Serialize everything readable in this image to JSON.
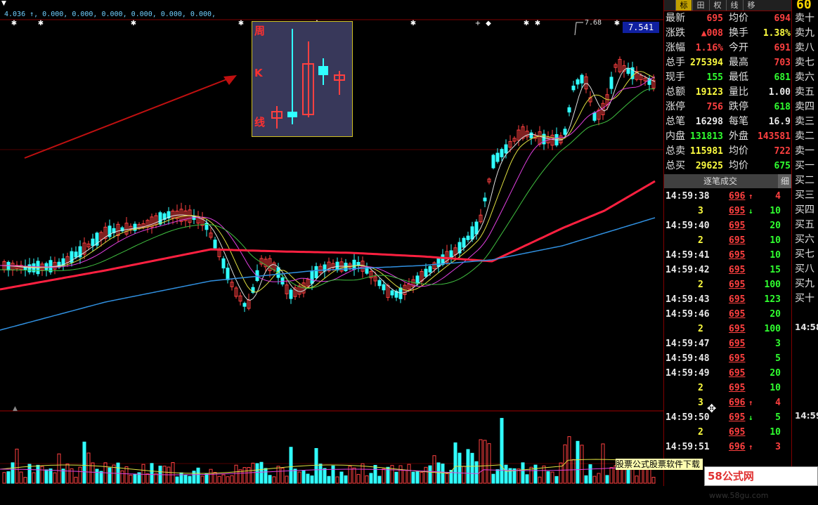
{
  "chart": {
    "ma_header": "4.036 ↑, 0.000, 0.000, 0.000, 0.000, 0.000, 0.000,",
    "peak_label": "7.68",
    "price_tag": "7.541",
    "inset_chars": [
      "周",
      "K",
      "线"
    ]
  },
  "tabs": [
    "标",
    "田",
    "权",
    "线",
    "移"
  ],
  "quote": [
    {
      "l1": "最新",
      "v1": "695",
      "c1": "red",
      "l2": "均价",
      "v2": "694",
      "c2": "red"
    },
    {
      "l1": "涨跌",
      "v1": "▲008",
      "c1": "red",
      "l2": "换手",
      "v2": "1.38%",
      "c2": "yel"
    },
    {
      "l1": "涨幅",
      "v1": "1.16%",
      "c1": "red",
      "l2": "今开",
      "v2": "691",
      "c2": "red"
    },
    {
      "l1": "总手",
      "v1": "275394",
      "c1": "yel",
      "l2": "最高",
      "v2": "703",
      "c2": "red"
    },
    {
      "l1": "现手",
      "v1": "155",
      "c1": "grn",
      "l2": "最低",
      "v2": "681",
      "c2": "grn"
    },
    {
      "l1": "总额",
      "v1": "19123",
      "c1": "yel",
      "l2": "量比",
      "v2": "1.00",
      "c2": "wht"
    },
    {
      "l1": "涨停",
      "v1": "756",
      "c1": "red",
      "l2": "跌停",
      "v2": "618",
      "c2": "grn"
    },
    {
      "l1": "总笔",
      "v1": "16298",
      "c1": "wht",
      "l2": "每笔",
      "v2": "16.9",
      "c2": "wht"
    },
    {
      "l1": "内盘",
      "v1": "131813",
      "c1": "grn",
      "l2": "外盘",
      "v2": "143581",
      "c2": "red"
    },
    {
      "l1": "总卖",
      "v1": "115981",
      "c1": "yel",
      "l2": "均价",
      "v2": "722",
      "c2": "red"
    },
    {
      "l1": "总买",
      "v1": "29625",
      "c1": "yel",
      "l2": "均价",
      "v2": "675",
      "c2": "grn"
    }
  ],
  "ticks": {
    "title": "逐笔成交",
    "detail": "细",
    "rows": [
      {
        "time": "14:59:38",
        "count": "",
        "price": "696",
        "arrow": "↑",
        "dir": "up",
        "vol": "4",
        "vc": "red"
      },
      {
        "time": "",
        "count": "3",
        "price": "695",
        "arrow": "↓",
        "dir": "dn",
        "vol": "10",
        "vc": "grn"
      },
      {
        "time": "14:59:40",
        "count": "",
        "price": "695",
        "arrow": "",
        "dir": "",
        "vol": "20",
        "vc": "grn"
      },
      {
        "time": "",
        "count": "2",
        "price": "695",
        "arrow": "",
        "dir": "",
        "vol": "10",
        "vc": "grn"
      },
      {
        "time": "14:59:41",
        "count": "",
        "price": "695",
        "arrow": "",
        "dir": "",
        "vol": "10",
        "vc": "grn"
      },
      {
        "time": "14:59:42",
        "count": "",
        "price": "695",
        "arrow": "",
        "dir": "",
        "vol": "15",
        "vc": "grn"
      },
      {
        "time": "",
        "count": "2",
        "price": "695",
        "arrow": "",
        "dir": "",
        "vol": "100",
        "vc": "grn"
      },
      {
        "time": "14:59:43",
        "count": "",
        "price": "695",
        "arrow": "",
        "dir": "",
        "vol": "123",
        "vc": "grn"
      },
      {
        "time": "14:59:46",
        "count": "",
        "price": "695",
        "arrow": "",
        "dir": "",
        "vol": "20",
        "vc": "grn"
      },
      {
        "time": "",
        "count": "2",
        "price": "695",
        "arrow": "",
        "dir": "",
        "vol": "100",
        "vc": "grn"
      },
      {
        "time": "14:59:47",
        "count": "",
        "price": "695",
        "arrow": "",
        "dir": "",
        "vol": "3",
        "vc": "grn"
      },
      {
        "time": "14:59:48",
        "count": "",
        "price": "695",
        "arrow": "",
        "dir": "",
        "vol": "5",
        "vc": "grn"
      },
      {
        "time": "14:59:49",
        "count": "",
        "price": "695",
        "arrow": "",
        "dir": "",
        "vol": "20",
        "vc": "grn"
      },
      {
        "time": "",
        "count": "2",
        "price": "695",
        "arrow": "",
        "dir": "",
        "vol": "10",
        "vc": "grn"
      },
      {
        "time": "",
        "count": "3",
        "price": "696",
        "arrow": "↑",
        "dir": "up",
        "vol": "4",
        "vc": "red"
      },
      {
        "time": "14:59:50",
        "count": "",
        "price": "695",
        "arrow": "↓",
        "dir": "dn",
        "vol": "5",
        "vc": "grn"
      },
      {
        "time": "",
        "count": "2",
        "price": "695",
        "arrow": "",
        "dir": "",
        "vol": "10",
        "vc": "grn"
      },
      {
        "time": "14:59:51",
        "count": "",
        "price": "696",
        "arrow": "↑",
        "dir": "up",
        "vol": "3",
        "vc": "red"
      }
    ]
  },
  "strip": {
    "top_number": "60",
    "labels": [
      "卖十",
      "卖九",
      "卖八",
      "卖七",
      "卖六",
      "卖五",
      "卖四",
      "卖三",
      "卖二",
      "卖一",
      "买一",
      "买二",
      "买三",
      "买四",
      "买五",
      "买六",
      "买七",
      "买八",
      "买九",
      "买十"
    ],
    "times": [
      "14:58",
      "14:59"
    ]
  },
  "promo": "股票公式股票软件下载",
  "brand": {
    "name": "58公式网",
    "url": "www.58gu.com"
  },
  "colors": {
    "up": "#ff4040",
    "down": "#30ffff",
    "ma_red": "#ff2040",
    "ma_blue": "#3090e0",
    "ma_green": "#40c040",
    "ma_white": "#e0e0e0",
    "ma_yellow": "#e0e040",
    "ma_pink": "#e040e0"
  }
}
